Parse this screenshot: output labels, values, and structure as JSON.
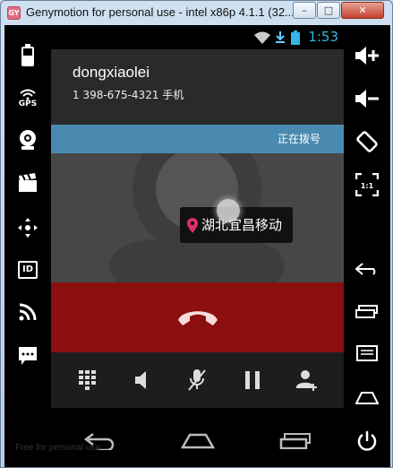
{
  "window": {
    "title": "Genymotion for personal use - intel x86p 4.1.1 (32...",
    "app_icon_text": "GY",
    "minimize": "–",
    "maximize": "□",
    "close": "✕"
  },
  "status": {
    "time": "1:53"
  },
  "call": {
    "name": "dongxiaolei",
    "number": "1 398-675-4321  手机",
    "state": "正在拨号",
    "location": "湖北宜昌移动"
  },
  "left_sidebar": [
    "battery-icon",
    "gps-icon",
    "webcam-icon",
    "clapper-icon",
    "dpad-icon",
    "id-icon",
    "rss-icon",
    "sms-icon"
  ],
  "left_sidebar_labels": {
    "gps": "GPS",
    "id": "ID"
  },
  "right_sidebar": [
    "volume-up-icon",
    "volume-down-icon",
    "rotate-icon",
    "scale-icon",
    "back-icon",
    "recent-apps-icon",
    "menu-icon",
    "home-icon",
    "power-icon"
  ],
  "right_sidebar_labels": {
    "scale": "1:1"
  },
  "controls": [
    "dialpad-icon",
    "speaker-icon",
    "mute-icon",
    "hold-icon",
    "add-call-icon"
  ],
  "watermark": "Free for personal use",
  "colors": {
    "state_bar": "#4a8ab0",
    "end_call": "#8b0f0f",
    "clock": "#33b5e5"
  }
}
